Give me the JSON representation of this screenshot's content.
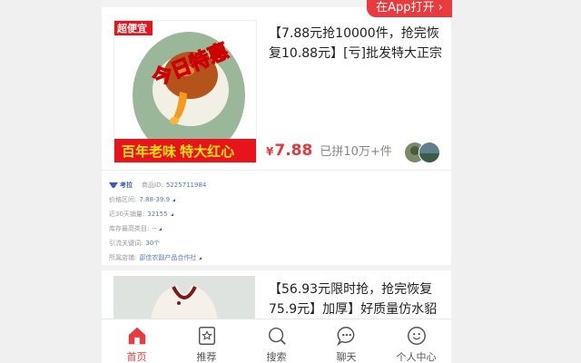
{
  "app_open_button": "在App打开",
  "product1": {
    "thumb_badge": "超便宜",
    "thumb_banner": "今日特惠",
    "thumb_footer": "百年老味 特大红心",
    "title": "【7.88元抢10000件，抢完恢复10.88元】[亏]批发特大正宗",
    "price_symbol": "¥",
    "price": "7.88",
    "sold": "已拼10万+件"
  },
  "info": {
    "logo_text": "考拉",
    "rows": [
      {
        "label": "商品ID:",
        "value": "5225711984"
      },
      {
        "label": "价格区间:",
        "value": "7.88-39.9"
      },
      {
        "label": "近30天销量:",
        "value": "32155"
      },
      {
        "label": "库存最高类目:",
        "value": "--"
      },
      {
        "label": "引流关键词:",
        "value": "30个"
      },
      {
        "label": "所属店铺:",
        "value": "邵佳农副产品合作社"
      }
    ]
  },
  "product2": {
    "title": "【56.93元限时抢，抢完恢复75.9元】加厚】好质量仿水貂"
  },
  "tabs": [
    {
      "label": "首页",
      "icon": "home-icon",
      "active": true
    },
    {
      "label": "推荐",
      "icon": "recommend-icon",
      "active": false
    },
    {
      "label": "搜索",
      "icon": "search-icon",
      "active": false
    },
    {
      "label": "聊天",
      "icon": "chat-icon",
      "active": false
    },
    {
      "label": "个人中心",
      "icon": "profile-icon",
      "active": false
    }
  ],
  "colors": {
    "accent": "#e93b3d",
    "price": "#e4393c",
    "link": "#5577cc"
  }
}
